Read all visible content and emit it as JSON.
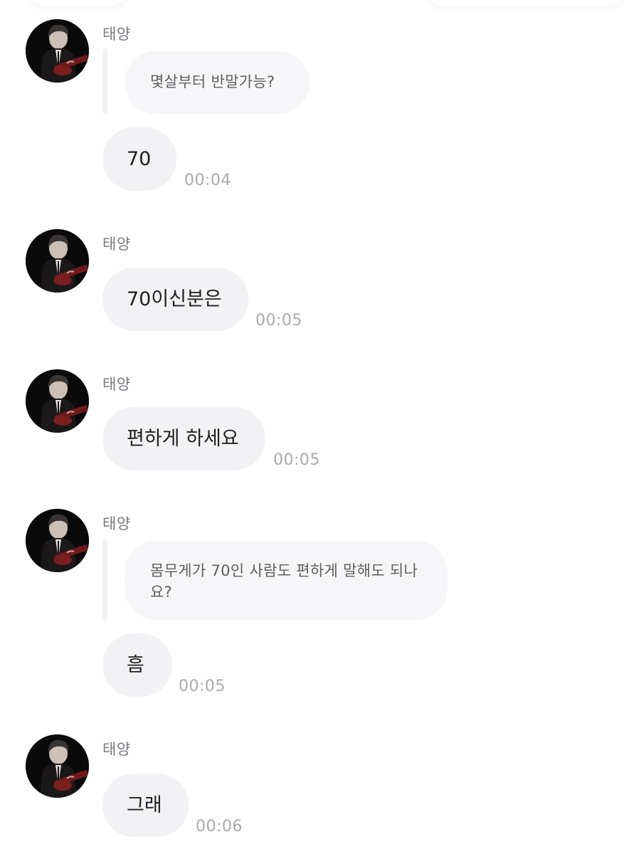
{
  "chat": {
    "groups": [
      {
        "sender": "태양",
        "quote": "몇살부터 반말가능?",
        "message": "70",
        "time": "00:04"
      },
      {
        "sender": "태양",
        "message": "70이신분은",
        "time": "00:05"
      },
      {
        "sender": "태양",
        "message": "편하게 하세요",
        "time": "00:05"
      },
      {
        "sender": "태양",
        "quote": "몸무게가 70인 사람도 편하게 말해도 되나요?",
        "message": "흠",
        "time": "00:05"
      },
      {
        "sender": "태양",
        "message": "그래",
        "time": "00:06"
      }
    ]
  },
  "icons": {
    "avatar": "profile-photo"
  },
  "colors": {
    "bubble": "#f2f2f4",
    "quote_bubble": "#f6f6f8",
    "sender_text": "#7a7a80",
    "time_text": "#a9a9ae"
  }
}
